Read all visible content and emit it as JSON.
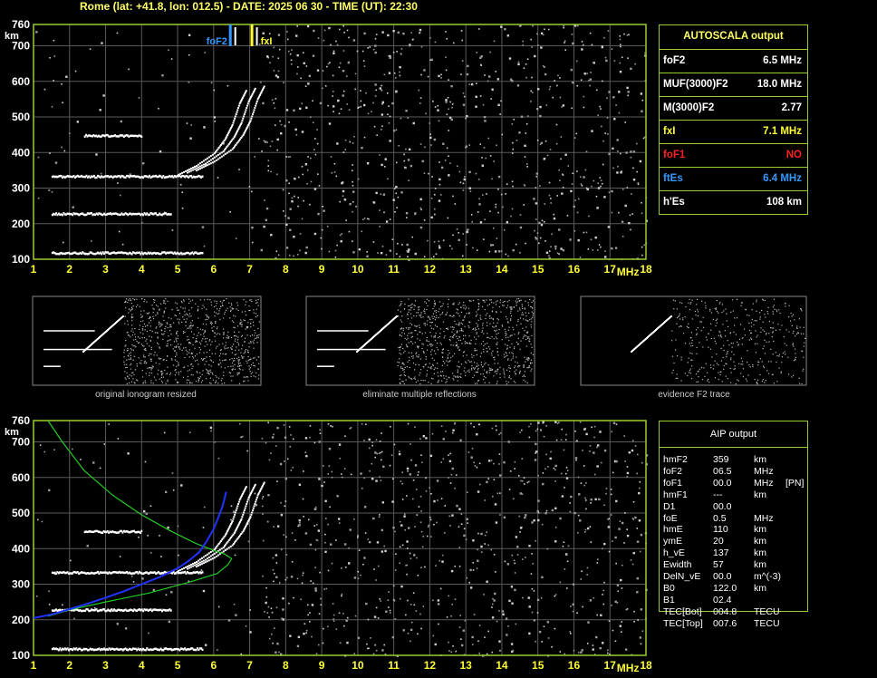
{
  "header": {
    "title": "Rome (lat: +41.8, lon: 012.5) - DATE: 2025 06 30 - TIME (UT): 22:30"
  },
  "colors": {
    "frame": "#9acd32",
    "grid": "#5a5a5a",
    "foF2": "#3399ff",
    "fxI": "#ffff33",
    "foF1": "#ff2222",
    "ftEs": "#3399ff",
    "profile": "#22cc22",
    "fit": "#2233ff",
    "label": "#ffff33"
  },
  "chart_data": [
    {
      "type": "scatter",
      "title": "",
      "xlabel": "MHz",
      "ylabel": "km",
      "xlim": [
        1,
        18
      ],
      "ylim": [
        100,
        760
      ],
      "xticks": [
        1,
        2,
        3,
        4,
        5,
        6,
        7,
        8,
        9,
        10,
        11,
        12,
        13,
        14,
        15,
        16,
        17,
        18
      ],
      "yticks": [
        100,
        200,
        300,
        400,
        500,
        600,
        700,
        760
      ],
      "markers": [
        {
          "name": "foF2",
          "label": "foF2",
          "x": 6.5
        },
        {
          "name": "fxI",
          "label": "fxI",
          "x": 7.1
        }
      ],
      "traces": [
        {
          "name": "E",
          "x_start": 1.5,
          "x_end": 5.7,
          "height": 120
        },
        {
          "name": "Es",
          "x_start": 1.5,
          "x_end": 4.8,
          "height": 230
        },
        {
          "name": "F2 low",
          "x_start": 1.5,
          "x_end": 5.7,
          "height": 335
        },
        {
          "name": "2xF2",
          "x_start": 2.4,
          "x_end": 4.0,
          "height": 450
        }
      ],
      "f2_trace": [
        [
          5.0,
          340
        ],
        [
          5.5,
          365
        ],
        [
          6.0,
          400
        ],
        [
          6.3,
          440
        ],
        [
          6.5,
          480
        ],
        [
          6.7,
          540
        ],
        [
          6.9,
          580
        ]
      ]
    },
    {
      "type": "line",
      "title": "",
      "xlabel": "MHz",
      "ylabel": "km",
      "xlim": [
        1,
        18
      ],
      "ylim": [
        100,
        760
      ],
      "xticks": [
        1,
        2,
        3,
        4,
        5,
        6,
        7,
        8,
        9,
        10,
        11,
        12,
        13,
        14,
        15,
        16,
        17,
        18
      ],
      "yticks": [
        100,
        200,
        300,
        400,
        500,
        600,
        700,
        760
      ],
      "series": [
        {
          "name": "",
          "points": [
            [
              1.4,
              760
            ],
            [
              1.8,
              700
            ],
            [
              2.4,
              620
            ],
            [
              3.2,
              550
            ],
            [
              4.0,
              495
            ],
            [
              4.8,
              450
            ],
            [
              5.5,
              415
            ],
            [
              6.0,
              395
            ],
            [
              6.3,
              385
            ],
            [
              6.5,
              372
            ],
            [
              6.4,
              355
            ],
            [
              6.1,
              330
            ],
            [
              5.3,
              305
            ],
            [
              4.2,
              275
            ],
            [
              3.0,
              250
            ],
            [
              2.0,
              228
            ],
            [
              1.4,
              210
            ]
          ]
        },
        {
          "name": "",
          "points": [
            [
              1.0,
              205
            ],
            [
              1.5,
              215
            ],
            [
              2.0,
              230
            ],
            [
              2.5,
              245
            ],
            [
              3.0,
              262
            ],
            [
              3.5,
              280
            ],
            [
              4.0,
              300
            ],
            [
              4.5,
              320
            ],
            [
              5.0,
              345
            ],
            [
              5.3,
              365
            ],
            [
              5.6,
              390
            ],
            [
              5.8,
              420
            ],
            [
              6.0,
              455
            ],
            [
              6.1,
              480
            ],
            [
              6.25,
              520
            ],
            [
              6.35,
              560
            ]
          ]
        }
      ]
    }
  ],
  "autoscala": {
    "title": "AUTOSCALA output",
    "rows": [
      {
        "key": "foF2",
        "value": "6.5 MHz",
        "color": "#ffffff"
      },
      {
        "key": "MUF(3000)F2",
        "value": "18.0 MHz",
        "color": "#ffffff"
      },
      {
        "key": "M(3000)F2",
        "value": "2.77",
        "color": "#ffffff"
      },
      {
        "key": "fxI",
        "value": "7.1 MHz",
        "color": "#ffff33"
      },
      {
        "key": "foF1",
        "value": "NO",
        "color": "#ff2222"
      },
      {
        "key": "ftEs",
        "value": "6.4 MHz",
        "color": "#3399ff"
      },
      {
        "key": "h'Es",
        "value": "108 km",
        "color": "#ffffff"
      }
    ]
  },
  "thumbnails": [
    {
      "caption": "original ionogram resized"
    },
    {
      "caption": "eliminate multiple reflections"
    },
    {
      "caption": "evidence F2 trace"
    }
  ],
  "aip": {
    "title": "AIP output",
    "rows": [
      {
        "k": "hmF2",
        "v": "359",
        "u": "km",
        "x": ""
      },
      {
        "k": "foF2",
        "v": "06.5",
        "u": "MHz",
        "x": ""
      },
      {
        "k": "foF1",
        "v": "00.0",
        "u": "MHz",
        "x": "[PN]"
      },
      {
        "k": "hmF1",
        "v": "---",
        "u": "km",
        "x": ""
      },
      {
        "k": "D1",
        "v": "00.0",
        "u": "",
        "x": ""
      },
      {
        "k": "foE",
        "v": "0.5",
        "u": "MHz",
        "x": ""
      },
      {
        "k": "hmE",
        "v": "110",
        "u": "km",
        "x": ""
      },
      {
        "k": "ymE",
        "v": "20",
        "u": "km",
        "x": ""
      },
      {
        "k": "h_vE",
        "v": "137",
        "u": "km",
        "x": ""
      },
      {
        "k": "Ewidth",
        "v": "57",
        "u": "km",
        "x": ""
      },
      {
        "k": "DelN_vE",
        "v": "00.0",
        "u": "m^(-3)",
        "x": ""
      },
      {
        "k": "B0",
        "v": "122.0",
        "u": "km",
        "x": ""
      },
      {
        "k": "B1",
        "v": "02.4",
        "u": "",
        "x": ""
      },
      {
        "k": "TEC[Bot]",
        "v": "004.8",
        "u": "TECU",
        "x": ""
      },
      {
        "k": "TEC[Top]",
        "v": "007.6",
        "u": "TECU",
        "x": ""
      }
    ]
  }
}
